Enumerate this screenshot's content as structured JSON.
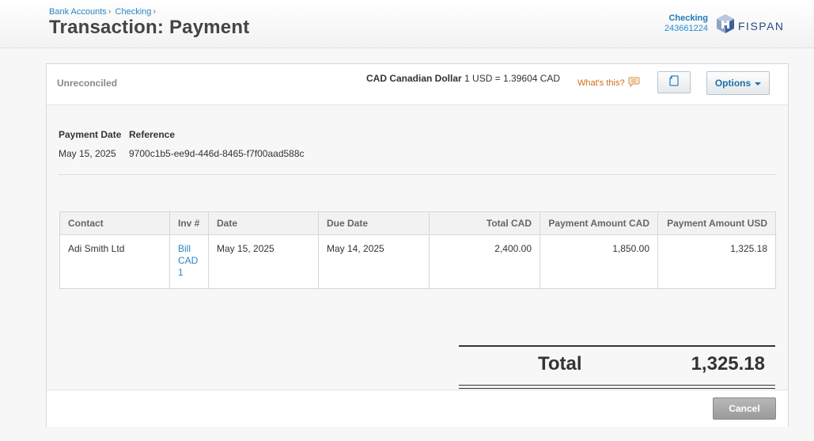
{
  "breadcrumb": {
    "items": [
      "Bank Accounts",
      "Checking"
    ],
    "separator": "›"
  },
  "page": {
    "title": "Transaction: Payment"
  },
  "account": {
    "name": "Checking",
    "number": "243661224"
  },
  "brand": {
    "name": "FISPAN",
    "icon": "fispan-cube-logo"
  },
  "panel": {
    "status": "Unreconciled",
    "currency_code": "CAD Canadian Dollar",
    "exchange_rate": "1 USD = 1.39604 CAD",
    "whats_this": "What's this?",
    "copy_icon": "copy-document-icon",
    "options_label": "Options"
  },
  "meta": {
    "payment_date_label": "Payment Date",
    "payment_date": "May 15, 2025",
    "reference_label": "Reference",
    "reference": "9700c1b5-ee9d-446d-8465-f7f00aad588c"
  },
  "table": {
    "headers": [
      "Contact",
      "Inv #",
      "Date",
      "Due Date",
      "Total CAD",
      "Payment Amount CAD",
      "Payment Amount USD"
    ],
    "rows": [
      {
        "contact": "Adi Smith Ltd",
        "invoice": "Bill CAD 1",
        "date": "May 15, 2025",
        "due_date": "May 14, 2025",
        "total_cad": "2,400.00",
        "payment_cad": "1,850.00",
        "payment_usd": "1,325.18"
      }
    ]
  },
  "totals": {
    "label": "Total",
    "value": "1,325.18"
  },
  "footer": {
    "cancel_label": "Cancel"
  },
  "colors": {
    "link": "#2a86c4",
    "accent_orange": "#d06d14",
    "brand_navy": "#2a4a86"
  }
}
